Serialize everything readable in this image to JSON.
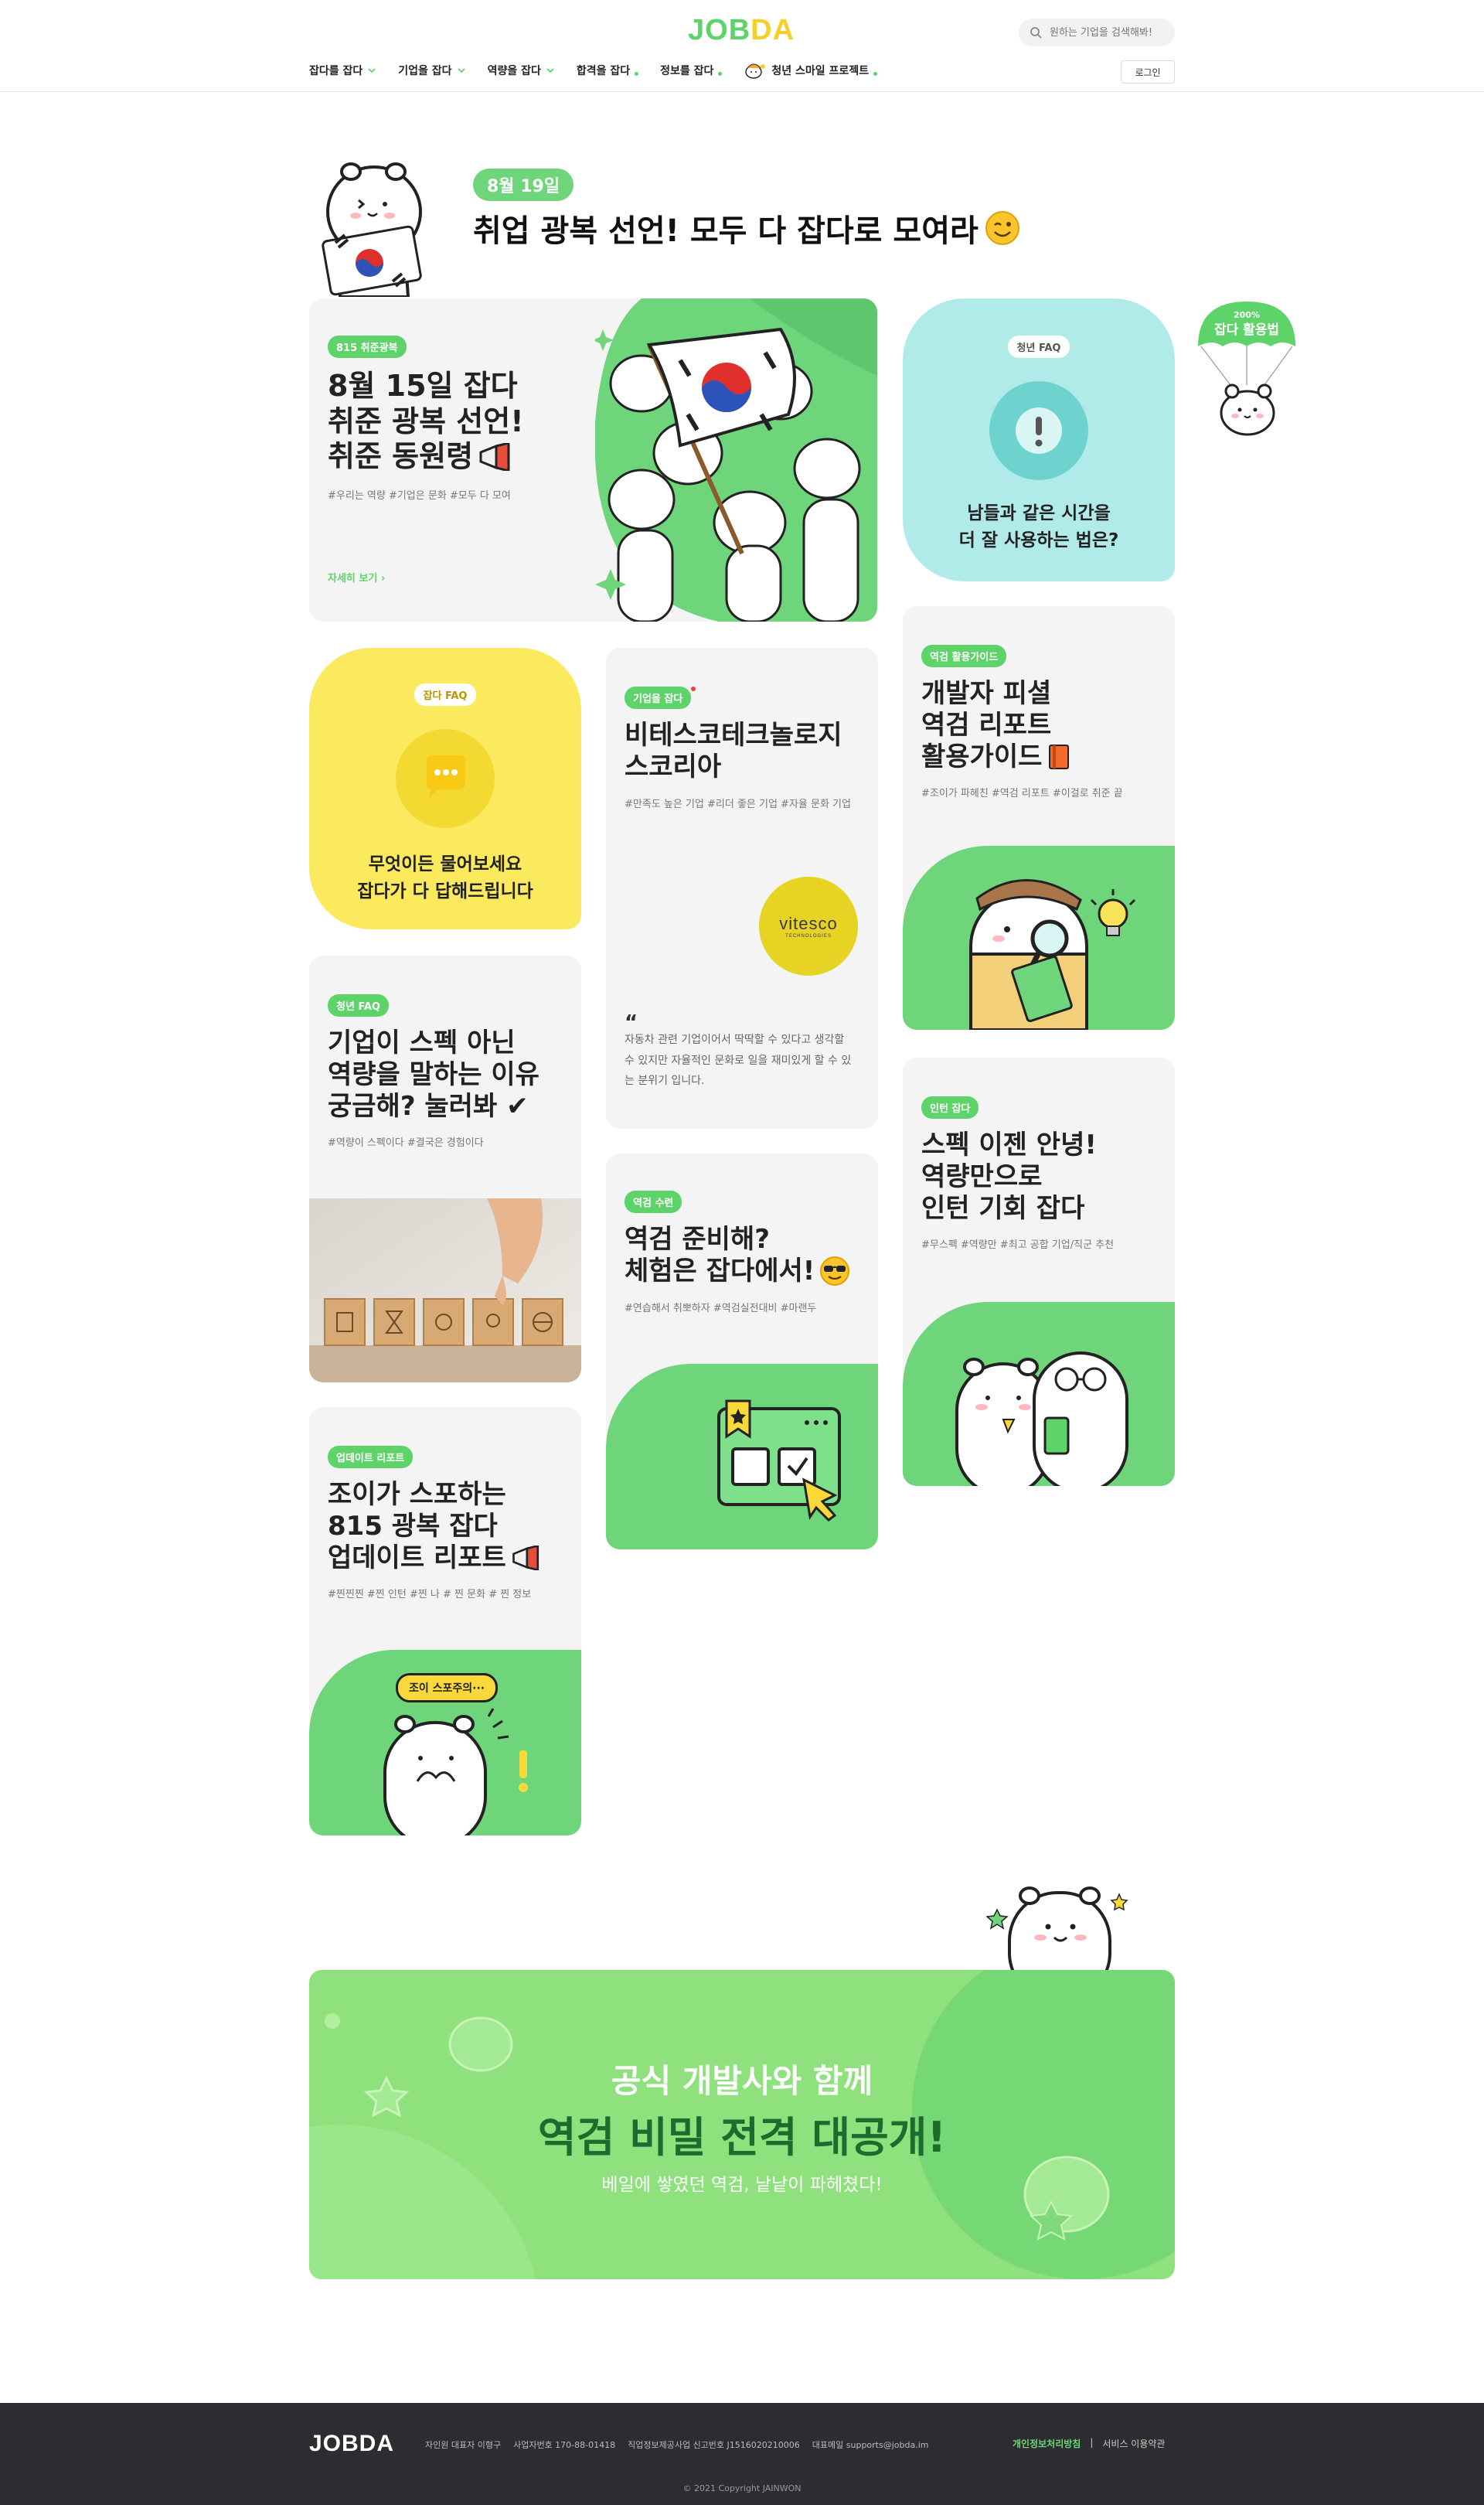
{
  "header": {
    "logo_job": "JOB",
    "logo_da": "DA",
    "search_placeholder": "원하는 기업을 검색해봐!",
    "nav": [
      "잡다를 잡다",
      "기업을 잡다",
      "역량을 잡다",
      "합격을 잡다",
      "정보를 잡다",
      "청년 스마일 프로젝트"
    ],
    "login_label": "로그인"
  },
  "hero": {
    "date": "8월 19일",
    "title": "취업 광복 선언! 모두 다 잡다로 모여라"
  },
  "cards": {
    "liberation": {
      "tag": "815 취준광복",
      "title_lines": [
        "8월 15일 잡다",
        "취준 광복 선언!",
        "취준 동원령"
      ],
      "tags": "#우리는 역량 #기업은 문화 #모두 다 모여",
      "more": "자세히 보기"
    },
    "youth_faq_time": {
      "tag": "청년 FAQ",
      "text_lines": [
        "남들과 같은 시간을",
        "더 잘 사용하는 법은?"
      ]
    },
    "float_badge": {
      "line1": "200%",
      "line2": "잡다 활용법"
    },
    "jobda_faq": {
      "tag": "잡다 FAQ",
      "text_lines": [
        "무엇이든 물어보세요",
        "잡다가 다 답해드립니다"
      ]
    },
    "company": {
      "tag": "기업을 잡다",
      "title_lines": [
        "비테스코테크놀로지",
        "스코리아"
      ],
      "tags": "#만족도 높은 기업 #리더 좋은 기업 #자율 문화 기업",
      "logo_text": "vitesco",
      "logo_sub": "TECHNOLOGIES",
      "quote_mark": "“",
      "quote": "자동차 관련 기업이어서 딱딱할 수 있다고 생각할 수 있지만 자율적인 문화로 일을 재미있게 할 수 있는 분위기 입니다."
    },
    "dev_guide": {
      "tag": "역검 활용가이드",
      "title_lines": [
        "개발자 피셜",
        "역검 리포트",
        "활용가이드"
      ],
      "tags": "#조이가 파헤친 #역검 리포트 #이걸로 취준 끝"
    },
    "youth_faq_spec": {
      "tag": "청년 FAQ",
      "title_lines": [
        "기업이 스펙 아닌",
        "역량을 말하는 이유",
        "궁금해? 눌러봐 ✔"
      ],
      "tags": "#역량이 스펙이다 #결국은 경험이다"
    },
    "prep": {
      "tag": "역검 수련",
      "title_lines": [
        "역검 준비해?",
        "체험은 잡다에서!"
      ],
      "tags": "#연습해서 취뽀하자 #역검실전대비 #마랜두"
    },
    "intern": {
      "tag": "인턴 잡다",
      "title_lines": [
        "스펙 이젠 안녕!",
        "역량만으로",
        "인턴 기회 잡다"
      ],
      "tags": "#무스펙 #역량만 #최고 공합 기업/직군 추천"
    },
    "update": {
      "tag": "업데이트 리포트",
      "title_lines": [
        "조이가 스포하는",
        "815 광복 잡다",
        "업데이트 리포트"
      ],
      "tags": "#찐찐찐 #찐 인턴 #찐 나 # 찐 문화 # 찐 정보",
      "bubble": "조이 스포주의···"
    }
  },
  "banner": {
    "sub": "공식 개발사와 함께",
    "title": "역검 비밀 전격 대공개!",
    "desc": "베일에 쌓였던 역검, 낱낱이 파헤쳤다!"
  },
  "footer": {
    "logo": "JOBDA",
    "info": [
      "자인원 대표자 이형구",
      "사업자번호 170-88-01418",
      "직업정보제공사업 신고번호 J1516020210006",
      "대표메일 supports@jobda.im"
    ],
    "privacy": "개인정보처리방침",
    "sep": "|",
    "terms": "서비스 이용약관",
    "copyright": "© 2021 Copyright JAINWON"
  },
  "colors": {
    "brand_green": "#5ed36a",
    "brand_yellow": "#f4d12a",
    "mint": "#b1ebe9",
    "yellow_card": "#fbea5e",
    "footer_bg": "#2b2d31"
  }
}
